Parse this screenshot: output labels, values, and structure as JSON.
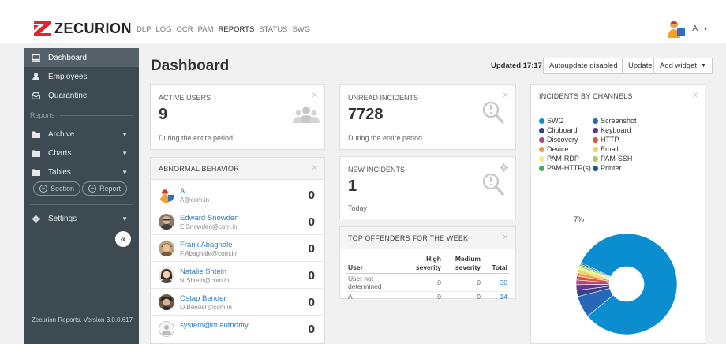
{
  "brand": {
    "name": "ZECURION"
  },
  "topnav": [
    {
      "label": "DLP",
      "active": false
    },
    {
      "label": "LOG",
      "active": false
    },
    {
      "label": "OCR",
      "active": false
    },
    {
      "label": "PAM",
      "active": false
    },
    {
      "label": "REPORTS",
      "active": true
    },
    {
      "label": "STATUS",
      "active": false
    },
    {
      "label": "SWG",
      "active": false
    }
  ],
  "user": {
    "name": "A",
    "caret": "▾"
  },
  "sidebar": {
    "items": [
      {
        "label": "Dashboard",
        "icon": "monitor-icon"
      },
      {
        "label": "Employees",
        "icon": "user-icon"
      },
      {
        "label": "Quarantine",
        "icon": "tray-icon"
      }
    ],
    "reports_section": "Reports",
    "report_items": [
      {
        "label": "Archive",
        "icon": "folder-icon"
      },
      {
        "label": "Charts",
        "icon": "folder-icon"
      },
      {
        "label": "Tables",
        "icon": "folder-icon"
      }
    ],
    "section_btn": "Section",
    "report_btn": "Report",
    "settings": "Settings",
    "collapse": "«",
    "version": "Zecurion Reports. Version 3.0.0.617"
  },
  "header": {
    "title": "Dashboard",
    "updated": "Updated 17:17",
    "autoupdate": "Autoupdate disabled",
    "update": "Update",
    "add_widget": "Add widget"
  },
  "active_users": {
    "title": "ACTIVE USERS",
    "value": "9",
    "period": "During the entire period"
  },
  "unread_incidents": {
    "title": "UNREAD INCIDENTS",
    "value": "7728",
    "period": "During the entire period"
  },
  "new_incidents": {
    "title": "NEW INCIDENTS",
    "value": "1",
    "period": "Today"
  },
  "abnormal": {
    "title": "ABNORMAL BEHAVIOR",
    "rows": [
      {
        "name": "A",
        "email": "A@com.in",
        "count": "0"
      },
      {
        "name": "Edward Snowden",
        "email": "E.Snowden@com.in",
        "count": "0"
      },
      {
        "name": "Frank Abagnale",
        "email": "F.Abagnale@com.in",
        "count": "0"
      },
      {
        "name": "Natalie Shtein",
        "email": "N.Shtein@com.in",
        "count": "0"
      },
      {
        "name": "Ostap Bender",
        "email": "O.Bender@com.in",
        "count": "0"
      },
      {
        "name": "system@nt authority",
        "email": "",
        "count": "0"
      }
    ]
  },
  "top_offenders": {
    "title": "TOP OFFENDERS FOR THE WEEK",
    "headers": {
      "user": "User",
      "high": "High severity",
      "medium": "Medium severity",
      "total": "Total"
    },
    "rows": [
      {
        "user": "User not determined",
        "high": "0",
        "medium": "0",
        "total": "30"
      },
      {
        "user": "A",
        "high": "0",
        "medium": "0",
        "total": "14"
      }
    ]
  },
  "channels": {
    "title": "INCIDENTS BY CHANNELS",
    "legend": [
      {
        "label": "SWG",
        "color": "#0b8ecf"
      },
      {
        "label": "Screenshot",
        "color": "#2667b8"
      },
      {
        "label": "Clipboard",
        "color": "#3b3f87"
      },
      {
        "label": "Keyboard",
        "color": "#5c3a8e"
      },
      {
        "label": "Discovery",
        "color": "#b1457e"
      },
      {
        "label": "HTTP",
        "color": "#e0533a"
      },
      {
        "label": "Device",
        "color": "#ef9a4a"
      },
      {
        "label": "Email",
        "color": "#f4d25a"
      },
      {
        "label": "PAM-RDP",
        "color": "#eef07a"
      },
      {
        "label": "PAM-SSH",
        "color": "#a6cf5e"
      },
      {
        "label": "PAM-HTTP(s)",
        "color": "#3fae6b"
      },
      {
        "label": "Printer",
        "color": "#1d5c88"
      }
    ],
    "visible_label": "7%"
  },
  "chart_data": {
    "type": "pie",
    "title": "INCIDENTS BY CHANNELS",
    "categories": [
      "SWG",
      "Screenshot",
      "Clipboard",
      "Keyboard",
      "Discovery",
      "HTTP",
      "Device",
      "Email",
      "PAM-RDP",
      "PAM-SSH",
      "PAM-HTTP(s)",
      "Printer"
    ],
    "values": [
      82,
      7,
      2,
      1.8,
      1.5,
      1.3,
      1.1,
      1,
      0.7,
      0.6,
      0.5,
      0.5
    ],
    "donut": true,
    "legend_position": "top"
  }
}
